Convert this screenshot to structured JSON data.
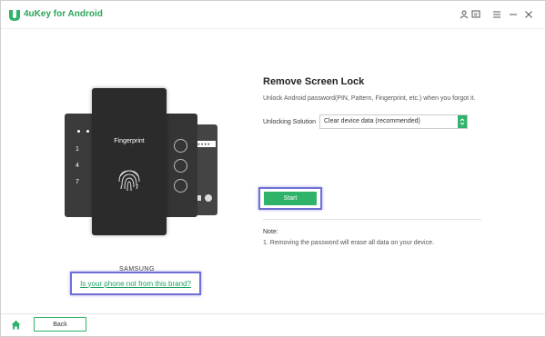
{
  "app": {
    "title": "4uKey for Android"
  },
  "titlebar": {
    "icons": [
      "user-icon",
      "feedback-icon",
      "menu-icon",
      "minimize-icon",
      "close-icon"
    ]
  },
  "left": {
    "fingerprint_label": "Fingerprint",
    "pin_numbers": [
      "1",
      "4",
      "7"
    ],
    "brand": "SAMSUNG",
    "brand_link": "Is your phone not from this brand?"
  },
  "main": {
    "heading": "Remove Screen Lock",
    "description": "Unlock Android password(PIN, Pattern, Fingerprint, etc.) when you forgot it.",
    "solution_label": "Unlocking Solution",
    "solution_value": "Clear device data (recommended)",
    "start_label": "Start",
    "note_title": "Note:",
    "note_text": "1. Removing the password will erase all data on your device."
  },
  "bottom": {
    "back_label": "Back"
  },
  "colors": {
    "accent": "#2fb36a",
    "highlight_border": "#6f6fd6",
    "phone_dark": "#2b2b2b"
  }
}
